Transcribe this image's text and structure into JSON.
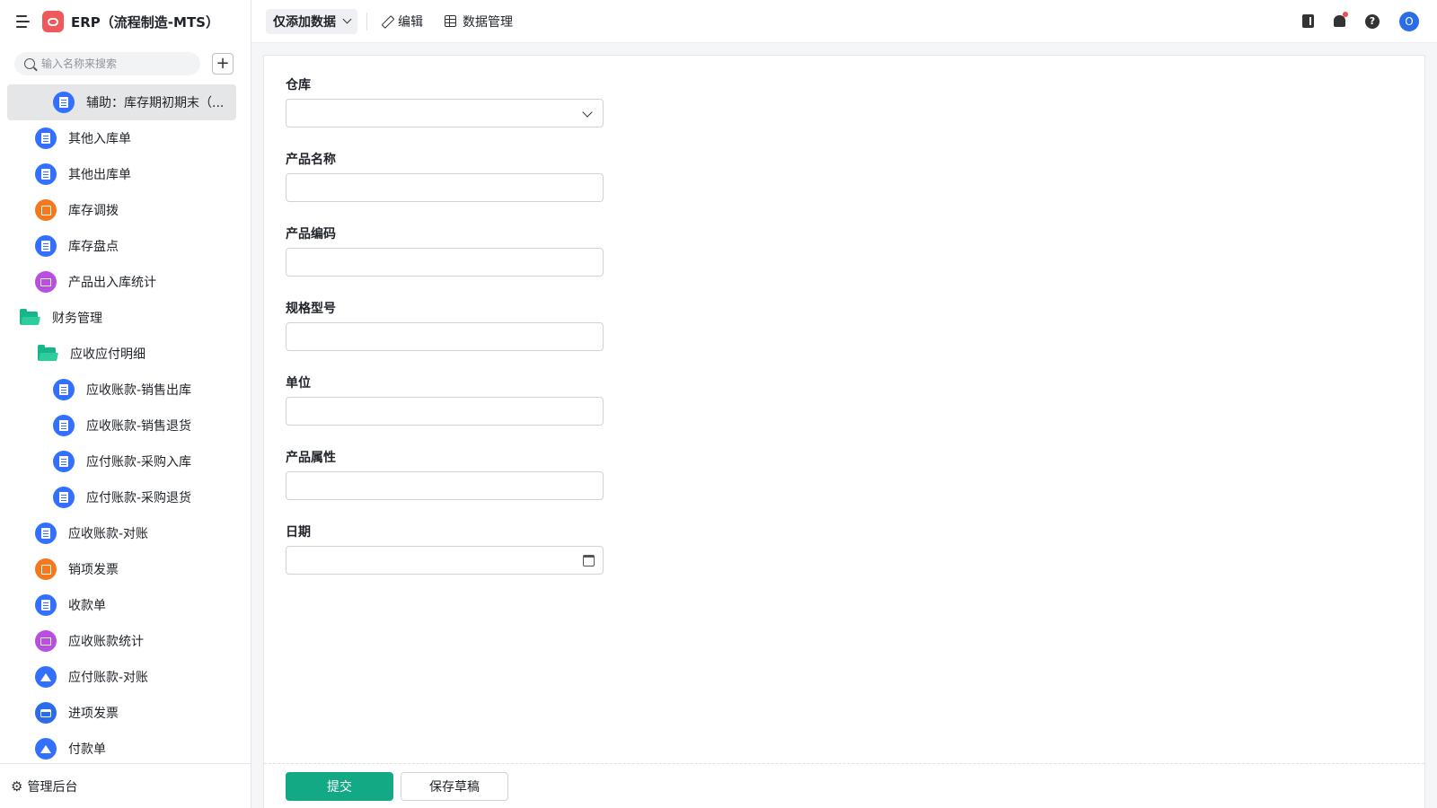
{
  "app": {
    "title": "ERP（流程制造-MTS）"
  },
  "sidebar": {
    "search_placeholder": "输入名称来搜索",
    "add_label": "+",
    "items": [
      {
        "label": "辅助：库存期初期末（...",
        "icon": "doc-icon"
      },
      {
        "label": "其他入库单",
        "icon": "doc-icon"
      },
      {
        "label": "其他出库单",
        "icon": "doc-icon"
      },
      {
        "label": "库存调拨",
        "icon": "warehouse-icon"
      },
      {
        "label": "库存盘点",
        "icon": "doc-icon"
      },
      {
        "label": "产品出入库统计",
        "icon": "chart-icon"
      },
      {
        "label": "财务管理",
        "icon": "folder-icon"
      },
      {
        "label": "应收应付明细",
        "icon": "folder-icon"
      },
      {
        "label": "应收账款-销售出库",
        "icon": "doc-icon"
      },
      {
        "label": "应收账款-销售退货",
        "icon": "doc-icon"
      },
      {
        "label": "应付账款-采购入库",
        "icon": "doc-icon"
      },
      {
        "label": "应付账款-采购退货",
        "icon": "doc-icon"
      },
      {
        "label": "应收账款-对账",
        "icon": "doc-icon"
      },
      {
        "label": "销项发票",
        "icon": "warehouse-icon"
      },
      {
        "label": "收款单",
        "icon": "doc-icon"
      },
      {
        "label": "应收账款统计",
        "icon": "chart-icon"
      },
      {
        "label": "应付账款-对账",
        "icon": "house-icon"
      },
      {
        "label": "进项发票",
        "icon": "card-icon"
      },
      {
        "label": "付款单",
        "icon": "house-icon"
      }
    ],
    "footer_label": "管理后台"
  },
  "toolbar": {
    "mode_label": "仅添加数据",
    "edit_label": "编辑",
    "data_manage_label": "数据管理",
    "avatar_letter": "O"
  },
  "form": {
    "fields": [
      {
        "label": "仓库",
        "type": "select",
        "value": ""
      },
      {
        "label": "产品名称",
        "type": "text",
        "value": ""
      },
      {
        "label": "产品编码",
        "type": "text",
        "value": ""
      },
      {
        "label": "规格型号",
        "type": "text",
        "value": ""
      },
      {
        "label": "单位",
        "type": "text",
        "value": ""
      },
      {
        "label": "产品属性",
        "type": "text",
        "value": ""
      },
      {
        "label": "日期",
        "type": "date",
        "value": ""
      }
    ],
    "submit_label": "提交",
    "draft_label": "保存草稿"
  },
  "colors": {
    "accent": "#13a985",
    "primary_blue": "#3370ff",
    "orange": "#f5781e",
    "purple": "#b84fe0",
    "folder_green": "#18b48a"
  }
}
